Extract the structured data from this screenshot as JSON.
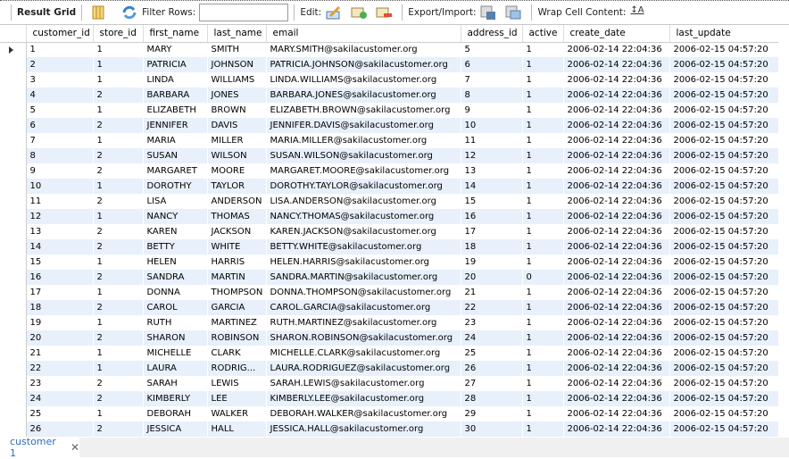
{
  "toolbar": {
    "result_grid": "Result Grid",
    "filter_rows": "Filter Rows:",
    "filter_value": "",
    "edit": "Edit:",
    "export_import": "Export/Import:",
    "wrap_cell": "Wrap Cell Content:"
  },
  "columns": [
    "customer_id",
    "store_id",
    "first_name",
    "last_name",
    "email",
    "address_id",
    "active",
    "create_date",
    "last_update"
  ],
  "rows": [
    [
      "1",
      "1",
      "MARY",
      "SMITH",
      "MARY.SMITH@sakilacustomer.org",
      "5",
      "1",
      "2006-02-14 22:04:36",
      "2006-02-15 04:57:20"
    ],
    [
      "2",
      "1",
      "PATRICIA",
      "JOHNSON",
      "PATRICIA.JOHNSON@sakilacustomer.org",
      "6",
      "1",
      "2006-02-14 22:04:36",
      "2006-02-15 04:57:20"
    ],
    [
      "3",
      "1",
      "LINDA",
      "WILLIAMS",
      "LINDA.WILLIAMS@sakilacustomer.org",
      "7",
      "1",
      "2006-02-14 22:04:36",
      "2006-02-15 04:57:20"
    ],
    [
      "4",
      "2",
      "BARBARA",
      "JONES",
      "BARBARA.JONES@sakilacustomer.org",
      "8",
      "1",
      "2006-02-14 22:04:36",
      "2006-02-15 04:57:20"
    ],
    [
      "5",
      "1",
      "ELIZABETH",
      "BROWN",
      "ELIZABETH.BROWN@sakilacustomer.org",
      "9",
      "1",
      "2006-02-14 22:04:36",
      "2006-02-15 04:57:20"
    ],
    [
      "6",
      "2",
      "JENNIFER",
      "DAVIS",
      "JENNIFER.DAVIS@sakilacustomer.org",
      "10",
      "1",
      "2006-02-14 22:04:36",
      "2006-02-15 04:57:20"
    ],
    [
      "7",
      "1",
      "MARIA",
      "MILLER",
      "MARIA.MILLER@sakilacustomer.org",
      "11",
      "1",
      "2006-02-14 22:04:36",
      "2006-02-15 04:57:20"
    ],
    [
      "8",
      "2",
      "SUSAN",
      "WILSON",
      "SUSAN.WILSON@sakilacustomer.org",
      "12",
      "1",
      "2006-02-14 22:04:36",
      "2006-02-15 04:57:20"
    ],
    [
      "9",
      "2",
      "MARGARET",
      "MOORE",
      "MARGARET.MOORE@sakilacustomer.org",
      "13",
      "1",
      "2006-02-14 22:04:36",
      "2006-02-15 04:57:20"
    ],
    [
      "10",
      "1",
      "DOROTHY",
      "TAYLOR",
      "DOROTHY.TAYLOR@sakilacustomer.org",
      "14",
      "1",
      "2006-02-14 22:04:36",
      "2006-02-15 04:57:20"
    ],
    [
      "11",
      "2",
      "LISA",
      "ANDERSON",
      "LISA.ANDERSON@sakilacustomer.org",
      "15",
      "1",
      "2006-02-14 22:04:36",
      "2006-02-15 04:57:20"
    ],
    [
      "12",
      "1",
      "NANCY",
      "THOMAS",
      "NANCY.THOMAS@sakilacustomer.org",
      "16",
      "1",
      "2006-02-14 22:04:36",
      "2006-02-15 04:57:20"
    ],
    [
      "13",
      "2",
      "KAREN",
      "JACKSON",
      "KAREN.JACKSON@sakilacustomer.org",
      "17",
      "1",
      "2006-02-14 22:04:36",
      "2006-02-15 04:57:20"
    ],
    [
      "14",
      "2",
      "BETTY",
      "WHITE",
      "BETTY.WHITE@sakilacustomer.org",
      "18",
      "1",
      "2006-02-14 22:04:36",
      "2006-02-15 04:57:20"
    ],
    [
      "15",
      "1",
      "HELEN",
      "HARRIS",
      "HELEN.HARRIS@sakilacustomer.org",
      "19",
      "1",
      "2006-02-14 22:04:36",
      "2006-02-15 04:57:20"
    ],
    [
      "16",
      "2",
      "SANDRA",
      "MARTIN",
      "SANDRA.MARTIN@sakilacustomer.org",
      "20",
      "0",
      "2006-02-14 22:04:36",
      "2006-02-15 04:57:20"
    ],
    [
      "17",
      "1",
      "DONNA",
      "THOMPSON",
      "DONNA.THOMPSON@sakilacustomer.org",
      "21",
      "1",
      "2006-02-14 22:04:36",
      "2006-02-15 04:57:20"
    ],
    [
      "18",
      "2",
      "CAROL",
      "GARCIA",
      "CAROL.GARCIA@sakilacustomer.org",
      "22",
      "1",
      "2006-02-14 22:04:36",
      "2006-02-15 04:57:20"
    ],
    [
      "19",
      "1",
      "RUTH",
      "MARTINEZ",
      "RUTH.MARTINEZ@sakilacustomer.org",
      "23",
      "1",
      "2006-02-14 22:04:36",
      "2006-02-15 04:57:20"
    ],
    [
      "20",
      "2",
      "SHARON",
      "ROBINSON",
      "SHARON.ROBINSON@sakilacustomer.org",
      "24",
      "1",
      "2006-02-14 22:04:36",
      "2006-02-15 04:57:20"
    ],
    [
      "21",
      "1",
      "MICHELLE",
      "CLARK",
      "MICHELLE.CLARK@sakilacustomer.org",
      "25",
      "1",
      "2006-02-14 22:04:36",
      "2006-02-15 04:57:20"
    ],
    [
      "22",
      "1",
      "LAURA",
      "RODRIG...",
      "LAURA.RODRIGUEZ@sakilacustomer.org",
      "26",
      "1",
      "2006-02-14 22:04:36",
      "2006-02-15 04:57:20"
    ],
    [
      "23",
      "2",
      "SARAH",
      "LEWIS",
      "SARAH.LEWIS@sakilacustomer.org",
      "27",
      "1",
      "2006-02-14 22:04:36",
      "2006-02-15 04:57:20"
    ],
    [
      "24",
      "2",
      "KIMBERLY",
      "LEE",
      "KIMBERLY.LEE@sakilacustomer.org",
      "28",
      "1",
      "2006-02-14 22:04:36",
      "2006-02-15 04:57:20"
    ],
    [
      "25",
      "1",
      "DEBORAH",
      "WALKER",
      "DEBORAH.WALKER@sakilacustomer.org",
      "29",
      "1",
      "2006-02-14 22:04:36",
      "2006-02-15 04:57:20"
    ],
    [
      "26",
      "2",
      "JESSICA",
      "HALL",
      "JESSICA.HALL@sakilacustomer.org",
      "30",
      "1",
      "2006-02-14 22:04:36",
      "2006-02-15 04:57:20"
    ]
  ],
  "tabs": [
    {
      "label": "customer 1",
      "close": "✕"
    }
  ]
}
